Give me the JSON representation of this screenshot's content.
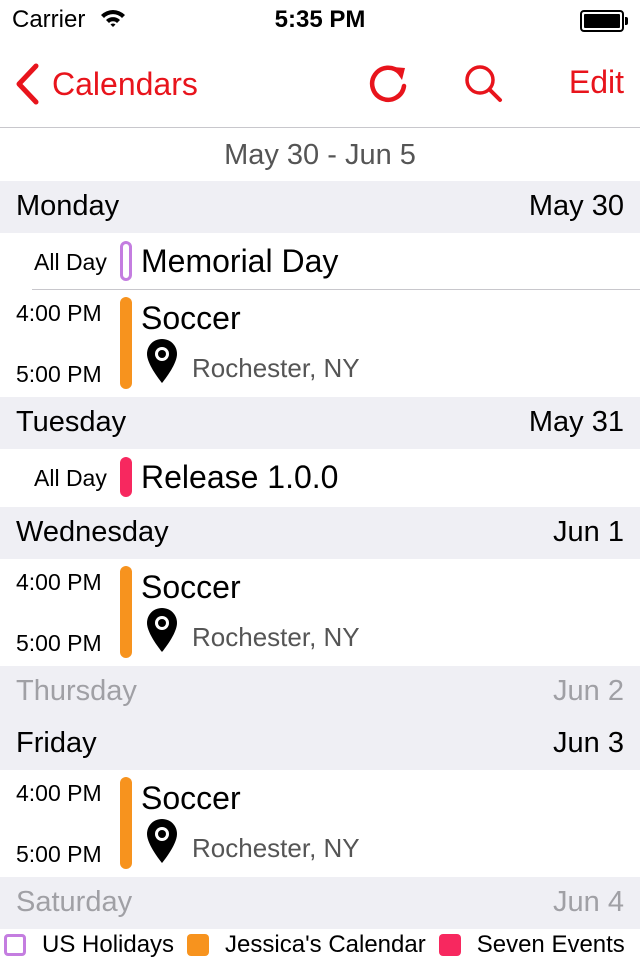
{
  "status_bar": {
    "carrier": "Carrier",
    "time": "5:35 PM"
  },
  "nav": {
    "back_label": "Calendars",
    "edit_label": "Edit",
    "accent_color": "#e8141c"
  },
  "week_range": "May 30 - Jun 5",
  "days": [
    {
      "name": "Monday",
      "date": "May 30",
      "events": [
        {
          "all_day_label": "All Day",
          "title": "Memorial Day",
          "calendar": "US Holidays"
        },
        {
          "start": "4:00 PM",
          "end": "5:00 PM",
          "title": "Soccer",
          "location": "Rochester, NY",
          "calendar": "Jessica's Calendar"
        }
      ]
    },
    {
      "name": "Tuesday",
      "date": "May 31",
      "events": [
        {
          "all_day_label": "All Day",
          "title": "Release 1.0.0",
          "calendar": "Seven Events"
        }
      ]
    },
    {
      "name": "Wednesday",
      "date": "Jun 1",
      "events": [
        {
          "start": "4:00 PM",
          "end": "5:00 PM",
          "title": "Soccer",
          "location": "Rochester, NY",
          "calendar": "Jessica's Calendar"
        }
      ]
    },
    {
      "name": "Thursday",
      "date": "Jun 2",
      "events": []
    },
    {
      "name": "Friday",
      "date": "Jun 3",
      "events": [
        {
          "start": "4:00 PM",
          "end": "5:00 PM",
          "title": "Soccer",
          "location": "Rochester, NY",
          "calendar": "Jessica's Calendar"
        }
      ]
    },
    {
      "name": "Saturday",
      "date": "Jun 4",
      "events": []
    }
  ],
  "legend": [
    {
      "label": "US Holidays",
      "color": "#c47de0",
      "style": "outline"
    },
    {
      "label": "Jessica's Calendar",
      "color": "#f7931e",
      "style": "filled"
    },
    {
      "label": "Seven Events",
      "color": "#f7285f",
      "style": "filled"
    }
  ],
  "icons": {
    "back": "chevron-left-icon",
    "refresh": "refresh-icon",
    "search": "search-icon",
    "location": "location-pin-icon",
    "wifi": "wifi-icon",
    "battery": "battery-icon"
  }
}
